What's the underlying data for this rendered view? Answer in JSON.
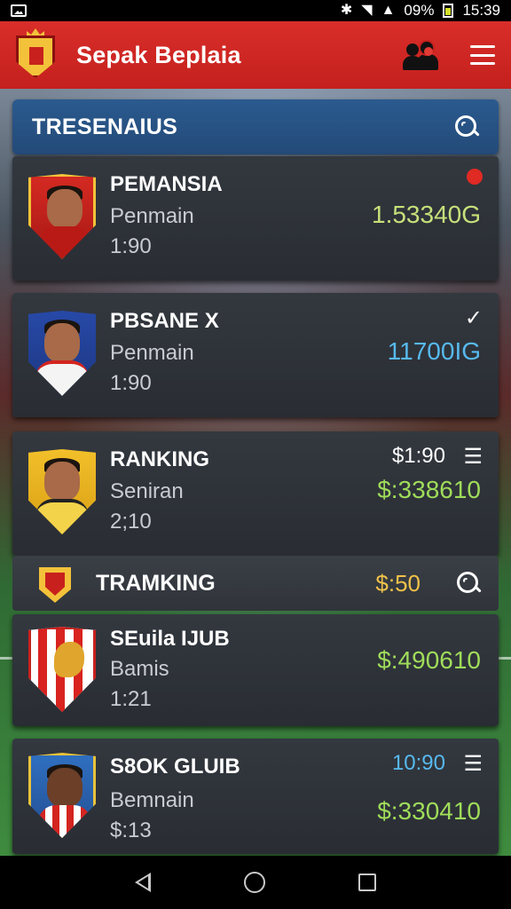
{
  "status_bar": {
    "battery_text": "09%",
    "time": "15:39",
    "icons": [
      "image-icon",
      "bluetooth-icon",
      "wifi-icon",
      "signal-icon",
      "battery-icon"
    ]
  },
  "app_bar": {
    "title": "Sepak Beplaia",
    "icons": [
      "club-crest-logo",
      "people-icon",
      "menu-icon"
    ]
  },
  "section": {
    "title": "TRESENAIUS"
  },
  "players": [
    {
      "name": "PEMANSIA",
      "role": "Penmain",
      "time": "1:90",
      "value": "1.53340G",
      "top_right": "",
      "kit_color": "#c8211d"
    },
    {
      "name": "PBSANE X",
      "role": "Penmain",
      "time": "1:90",
      "value": "11700IG",
      "top_right": "✓",
      "kit_color": "#ffffff"
    },
    {
      "name": "RANKING",
      "role": "Seniran",
      "time": "2;10",
      "value": "$:338610",
      "top_right": "$1:90",
      "kit_color": "#f0c020"
    }
  ],
  "ranking_bar": {
    "title": "TRAMKING",
    "value": "$:50"
  },
  "clubs": [
    {
      "name": "SEuila IJUB",
      "role": "Bamis",
      "time": "1:21",
      "value": "$:490610",
      "top_right": ""
    },
    {
      "name": "S8OK GLUIB",
      "role": "Bemnain",
      "time": "$:13",
      "value": "$:330410",
      "top_right": "10:90"
    }
  ],
  "colors": {
    "app_bar": "#d92e2a",
    "section_header": "#2b5a8f",
    "value_green": "#9fdc5a",
    "value_cyan": "#57b9ee",
    "value_yellow": "#f0c24a"
  }
}
